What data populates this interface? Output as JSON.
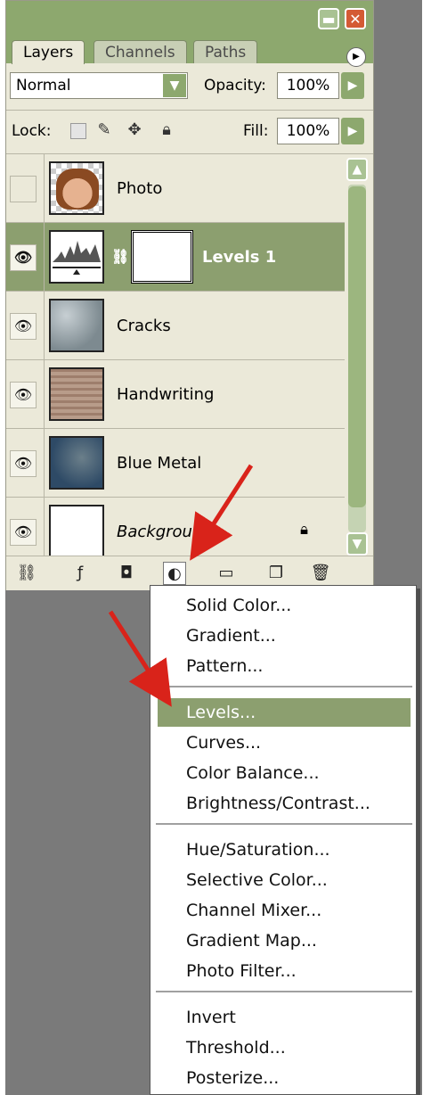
{
  "panel": {
    "tabs": [
      "Layers",
      "Channels",
      "Paths"
    ],
    "blend_mode": "Normal",
    "opacity_label": "Opacity:",
    "opacity_value": "100%",
    "lock_label": "Lock:",
    "fill_label": "Fill:",
    "fill_value": "100%",
    "layers": [
      {
        "name": "Photo",
        "visible": false,
        "selected": false
      },
      {
        "name": "Levels 1",
        "visible": true,
        "selected": true
      },
      {
        "name": "Cracks",
        "visible": true,
        "selected": false
      },
      {
        "name": "Handwriting",
        "visible": true,
        "selected": false
      },
      {
        "name": "Blue Metal",
        "visible": true,
        "selected": false
      },
      {
        "name": "Background",
        "visible": true,
        "selected": false,
        "locked": true
      }
    ]
  },
  "menu": {
    "items": [
      "Solid Color...",
      "Gradient...",
      "Pattern...",
      "Levels...",
      "Curves...",
      "Color Balance...",
      "Brightness/Contrast...",
      "Hue/Saturation...",
      "Selective Color...",
      "Channel Mixer...",
      "Gradient Map...",
      "Photo Filter...",
      "Invert",
      "Threshold...",
      "Posterize..."
    ],
    "highlighted": "Levels..."
  },
  "colors": {
    "accent": "#8c9f6f",
    "panel_bg": "#ebe9d9",
    "arrow": "#d9231a"
  }
}
